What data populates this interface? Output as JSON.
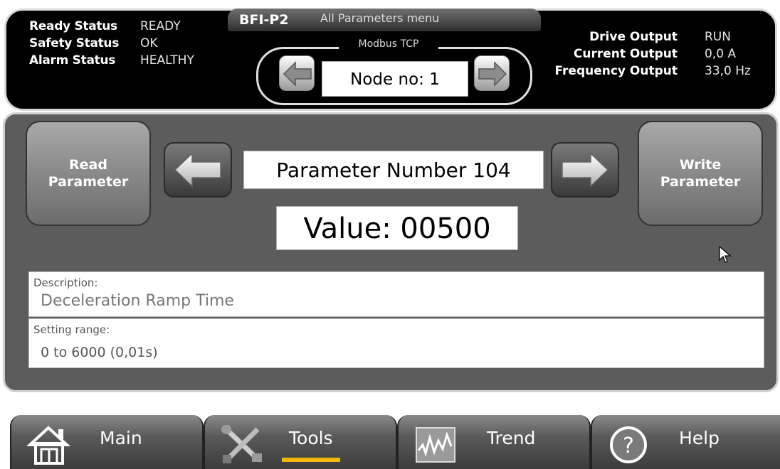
{
  "header": {
    "status": [
      {
        "label": "Ready Status",
        "value": "READY"
      },
      {
        "label": "Safety Status",
        "value": "OK"
      },
      {
        "label": "Alarm Status",
        "value": "HEALTHY"
      }
    ],
    "device": "BFI-P2",
    "menu_title": "All Parameters menu",
    "protocol": "Modbus TCP",
    "node": "Node no: 1",
    "outputs": [
      {
        "label": "Drive Output",
        "value": "RUN"
      },
      {
        "label": "Current Output",
        "value": "0,0 A"
      },
      {
        "label": "Frequency Output",
        "value": "33,0 Hz"
      }
    ]
  },
  "main": {
    "read_button": "Read Parameter",
    "write_button": "Write Parameter",
    "parameter": "Parameter Number 104",
    "value": "Value: 00500",
    "description_title": "Description:",
    "description": "Deceleration Ramp Time",
    "range_title": "Setting range:",
    "range": "0 to 6000 (0,01s)"
  },
  "nav": {
    "main": "Main",
    "tools": "Tools",
    "trend": "Trend",
    "help": "Help",
    "active": "Tools",
    "active_color": "#f2b700"
  }
}
